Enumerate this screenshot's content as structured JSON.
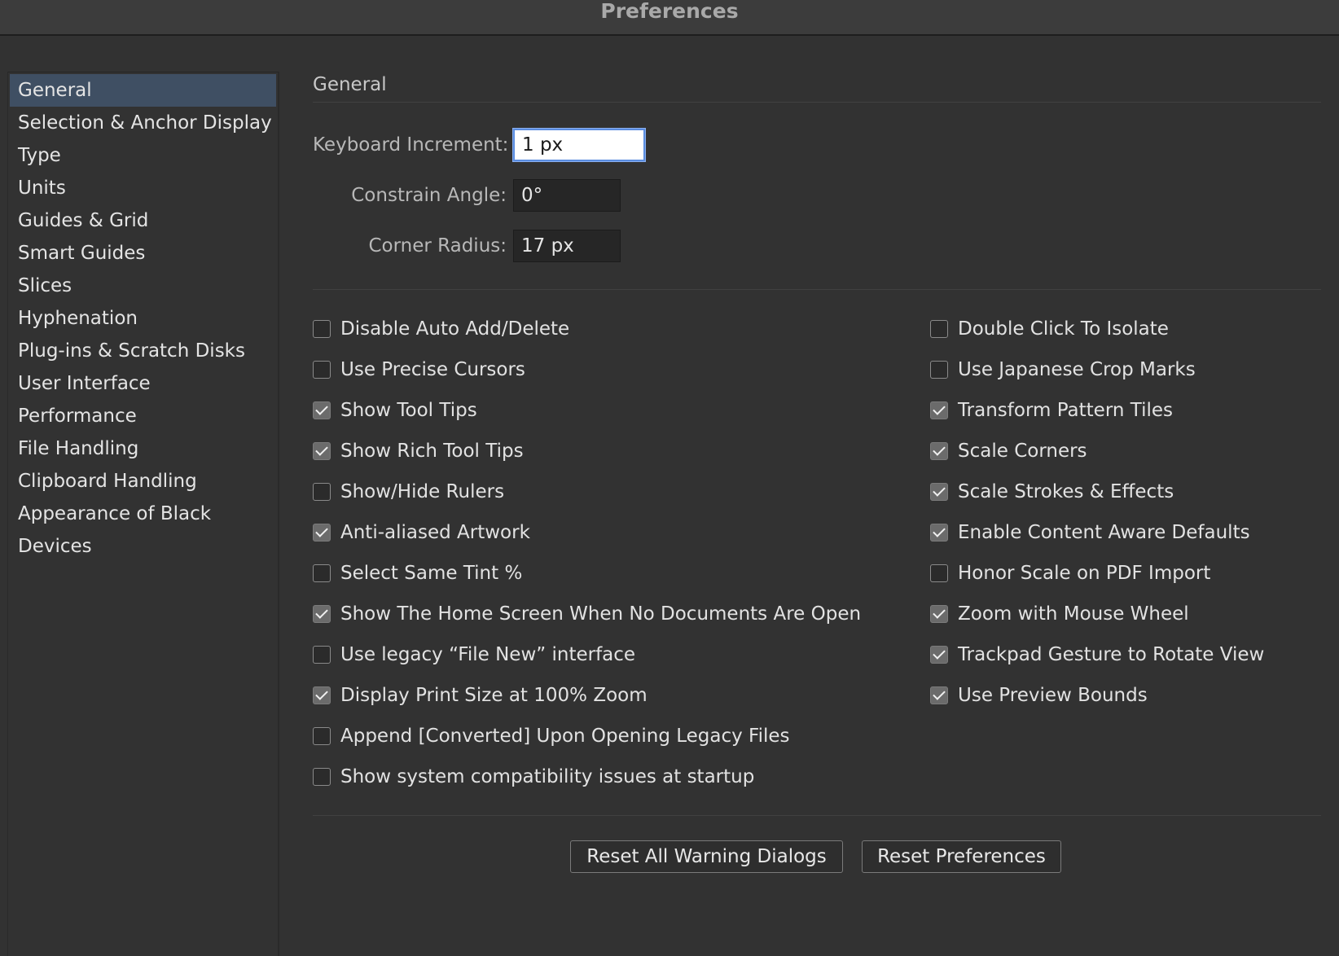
{
  "window": {
    "title": "Preferences"
  },
  "sidebar": {
    "items": [
      {
        "label": "General",
        "selected": true
      },
      {
        "label": "Selection & Anchor Display"
      },
      {
        "label": "Type"
      },
      {
        "label": "Units"
      },
      {
        "label": "Guides & Grid"
      },
      {
        "label": "Smart Guides"
      },
      {
        "label": "Slices"
      },
      {
        "label": "Hyphenation"
      },
      {
        "label": "Plug-ins & Scratch Disks"
      },
      {
        "label": "User Interface"
      },
      {
        "label": "Performance"
      },
      {
        "label": "File Handling"
      },
      {
        "label": "Clipboard Handling"
      },
      {
        "label": "Appearance of Black"
      },
      {
        "label": "Devices"
      }
    ]
  },
  "main": {
    "section_title": "General",
    "fields": {
      "keyboard_increment": {
        "label": "Keyboard Increment:",
        "value": "1 px"
      },
      "constrain_angle": {
        "label": "Constrain Angle:",
        "value": "0°"
      },
      "corner_radius": {
        "label": "Corner Radius:",
        "value": "17 px"
      }
    },
    "left_options": [
      {
        "label": "Disable Auto Add/Delete",
        "checked": false
      },
      {
        "label": "Use Precise Cursors",
        "checked": false
      },
      {
        "label": "Show Tool Tips",
        "checked": true
      },
      {
        "label": "Show Rich Tool Tips",
        "checked": true
      },
      {
        "label": "Show/Hide Rulers",
        "checked": false
      },
      {
        "label": "Anti-aliased Artwork",
        "checked": true
      },
      {
        "label": "Select Same Tint %",
        "checked": false
      },
      {
        "label": "Show The Home Screen When No Documents Are Open",
        "checked": true
      },
      {
        "label": "Use legacy “File New” interface",
        "checked": false
      },
      {
        "label": "Display Print Size at 100% Zoom",
        "checked": true
      },
      {
        "label": "Append [Converted] Upon Opening Legacy Files",
        "checked": false
      },
      {
        "label": "Show system compatibility issues at startup",
        "checked": false
      }
    ],
    "right_options": [
      {
        "label": "Double Click To Isolate",
        "checked": false
      },
      {
        "label": "Use Japanese Crop Marks",
        "checked": false
      },
      {
        "label": "Transform Pattern Tiles",
        "checked": true
      },
      {
        "label": "Scale Corners",
        "checked": true
      },
      {
        "label": "Scale Strokes & Effects",
        "checked": true
      },
      {
        "label": "Enable Content Aware Defaults",
        "checked": true
      },
      {
        "label": "Honor Scale on PDF Import",
        "checked": false
      },
      {
        "label": "Zoom with Mouse Wheel",
        "checked": true
      },
      {
        "label": "Trackpad Gesture to Rotate View",
        "checked": true
      },
      {
        "label": "Use Preview Bounds",
        "checked": true
      }
    ],
    "buttons": {
      "reset_warnings": "Reset All Warning Dialogs",
      "reset_preferences": "Reset Preferences"
    }
  }
}
